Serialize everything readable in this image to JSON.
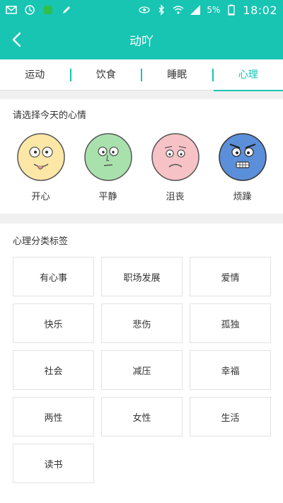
{
  "status_bar": {
    "battery_percent": "5%",
    "time": "18:02",
    "icons": [
      "mail-icon",
      "clock-icon",
      "app-icon",
      "pen-icon",
      "eye-icon",
      "bluetooth-icon",
      "wifi-icon",
      "signal-icon",
      "battery-icon"
    ]
  },
  "nav": {
    "title": "动吖",
    "back_icon": "chevron-left-icon"
  },
  "tabs": [
    {
      "label": "运动",
      "active": false
    },
    {
      "label": "饮食",
      "active": false
    },
    {
      "label": "睡眠",
      "active": false
    },
    {
      "label": "心理",
      "active": true
    }
  ],
  "mood_section": {
    "title": "请选择今天的心情",
    "moods": [
      {
        "label": "开心",
        "color": "#fde7a6"
      },
      {
        "label": "平静",
        "color": "#a9e1ad"
      },
      {
        "label": "沮丧",
        "color": "#f7c2c6"
      },
      {
        "label": "烦躁",
        "color": "#5b8fd9"
      }
    ]
  },
  "tags_section": {
    "title": "心理分类标签",
    "tags": [
      "有心事",
      "职场发展",
      "爱情",
      "快乐",
      "悲伤",
      "孤独",
      "社会",
      "减压",
      "幸福",
      "两性",
      "女性",
      "生活",
      "读书"
    ]
  },
  "colors": {
    "accent": "#18c4b2"
  }
}
